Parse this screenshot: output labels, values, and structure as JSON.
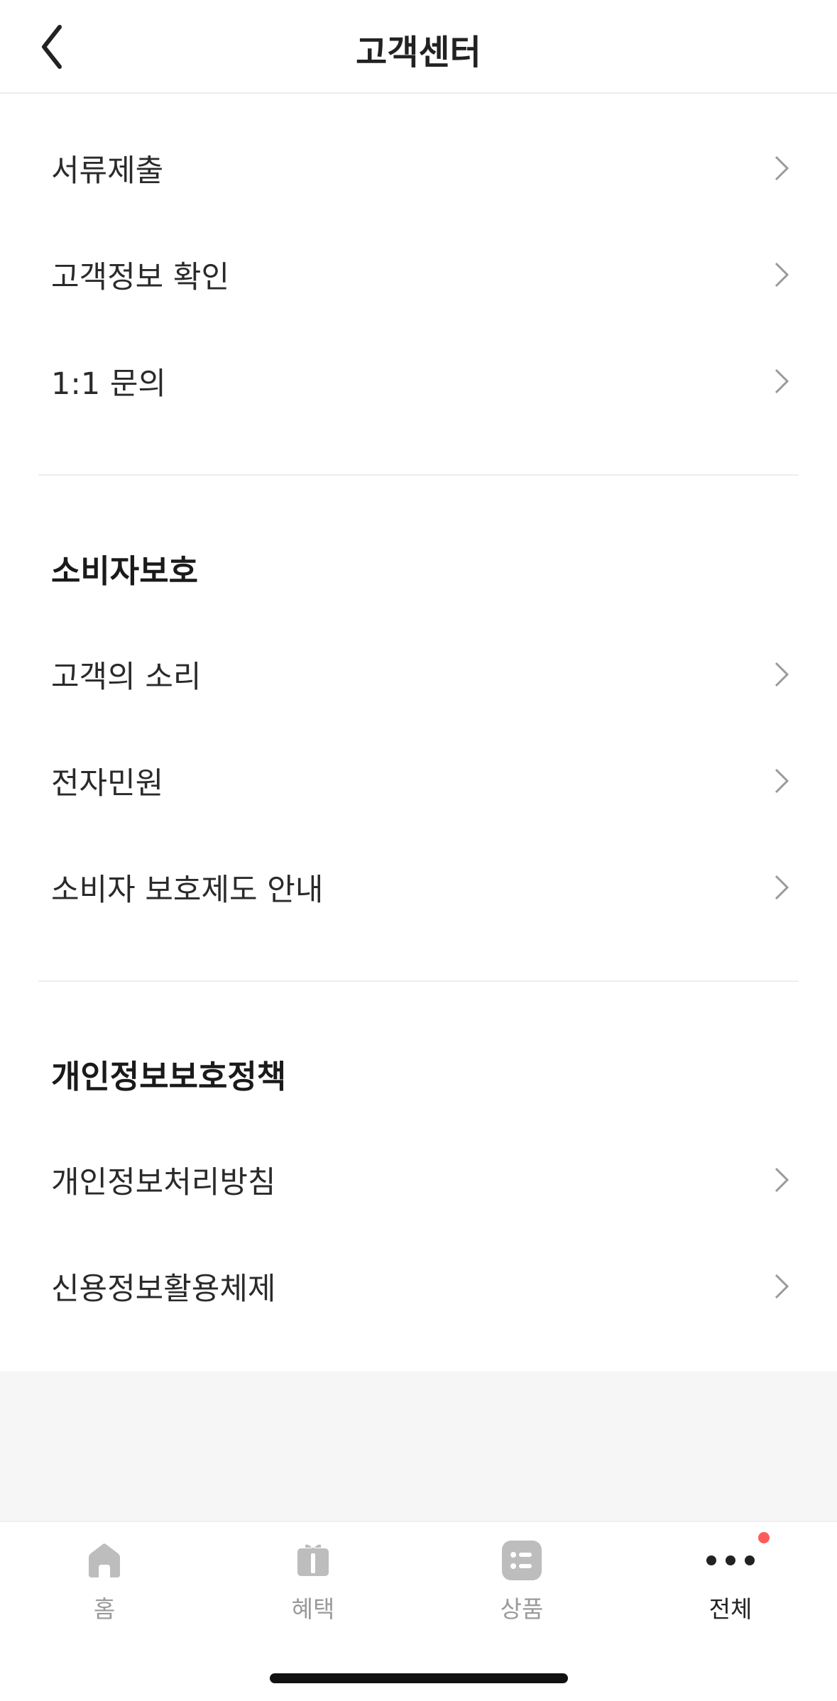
{
  "header": {
    "title": "고객센터",
    "back_icon": "chevron-left-icon"
  },
  "menu_top": [
    {
      "label": "서류제출"
    },
    {
      "label": "고객정보 확인"
    },
    {
      "label": "1:1 문의"
    }
  ],
  "sections": [
    {
      "title": "소비자보호",
      "items": [
        {
          "label": "고객의 소리"
        },
        {
          "label": "전자민원"
        },
        {
          "label": "소비자 보호제도 안내"
        }
      ]
    },
    {
      "title": "개인정보보호정책",
      "items": [
        {
          "label": "개인정보처리방침"
        },
        {
          "label": "신용정보활용체제"
        }
      ]
    }
  ],
  "tabbar": {
    "tabs": [
      {
        "label": "홈",
        "icon": "home-icon"
      },
      {
        "label": "혜택",
        "icon": "gift-icon"
      },
      {
        "label": "상품",
        "icon": "list-icon"
      },
      {
        "label": "전체",
        "icon": "more-dots-icon",
        "active": true
      }
    ],
    "badge_color": "#ff5a5a"
  },
  "colors": {
    "text": "#222222",
    "inactive_tab": "#9a9a9a",
    "chevron": "#9a9a9a",
    "gray_bg": "#f6f6f6"
  }
}
